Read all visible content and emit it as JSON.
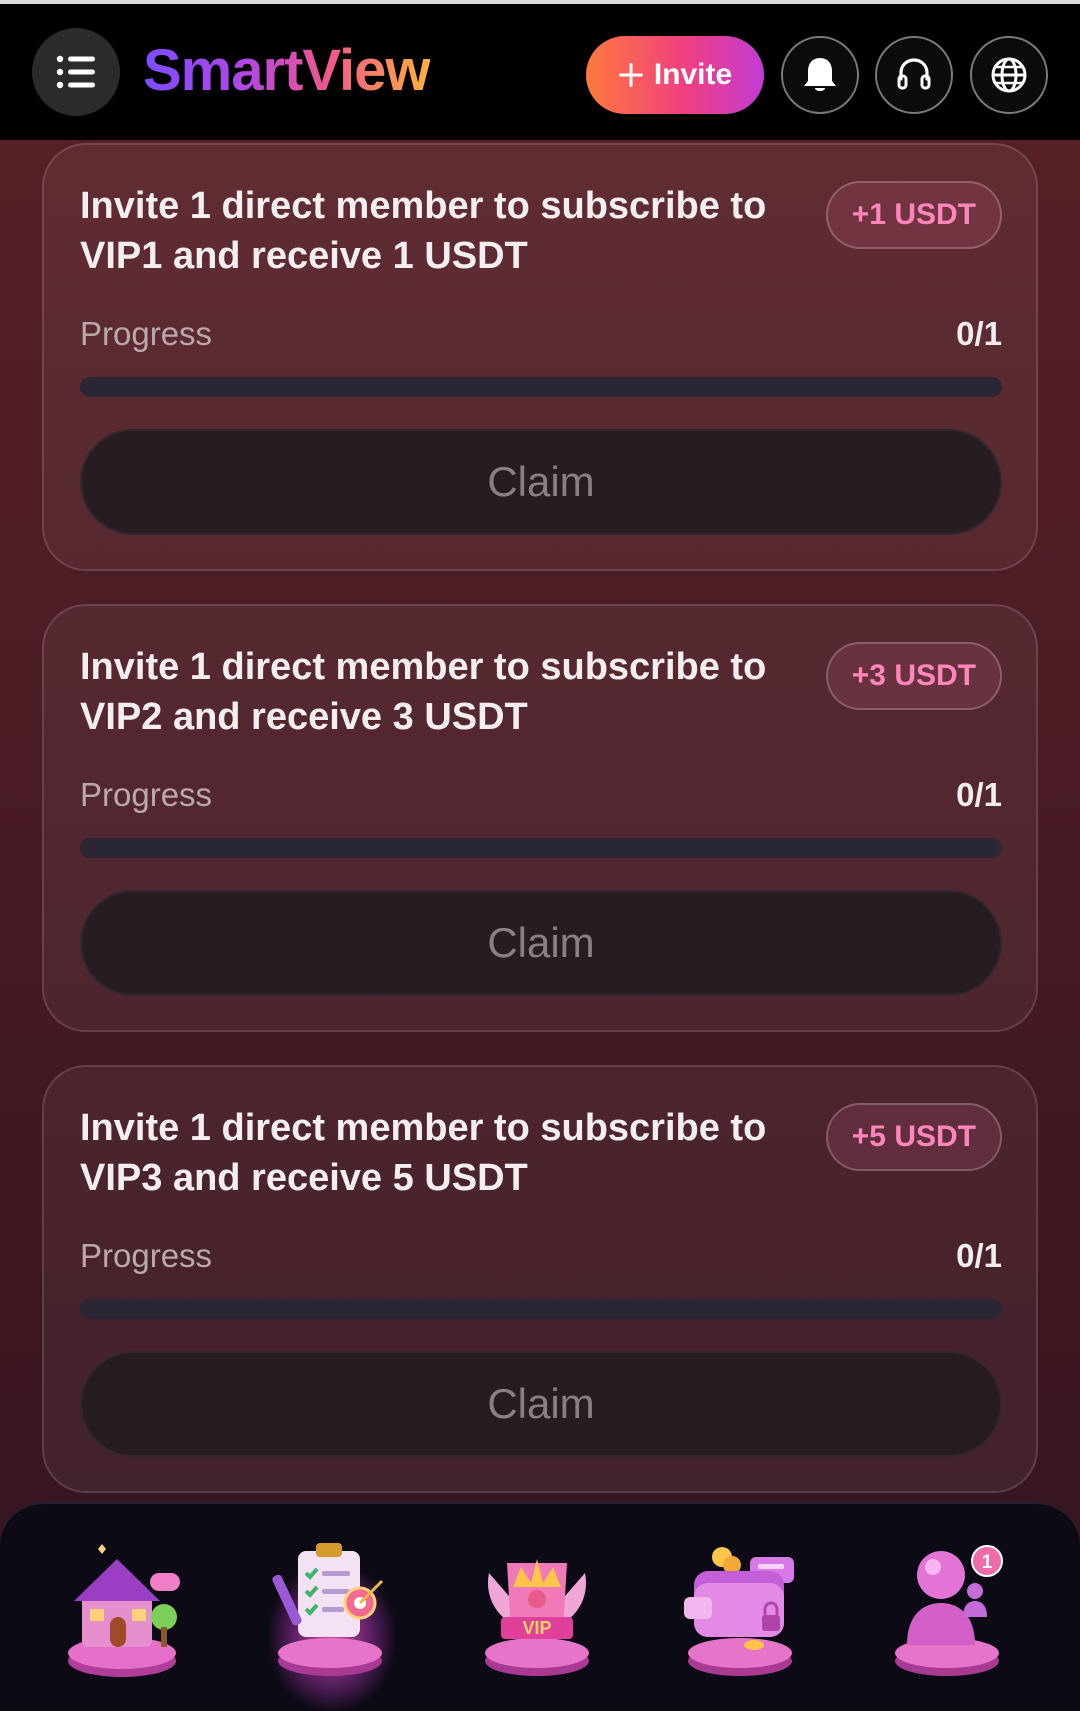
{
  "header": {
    "logo_text": "SmartView",
    "invite_label": "Invite",
    "icons": [
      "menu-icon",
      "bell-icon",
      "headset-icon",
      "globe-icon"
    ]
  },
  "tasks": [
    {
      "title": "Invite 1 direct member to subscribe to VIP1 and receive 1 USDT",
      "reward": "+1 USDT",
      "progress_label": "Progress",
      "progress_text": "0/1",
      "progress_fraction": 0,
      "claim_label": "Claim"
    },
    {
      "title": "Invite 1 direct member to subscribe to VIP2 and receive 3 USDT",
      "reward": "+3 USDT",
      "progress_label": "Progress",
      "progress_text": "0/1",
      "progress_fraction": 0,
      "claim_label": "Claim"
    },
    {
      "title": "Invite 1 direct member to subscribe to VIP3 and receive 5 USDT",
      "reward": "+5 USDT",
      "progress_label": "Progress",
      "progress_text": "0/1",
      "progress_fraction": 0,
      "claim_label": "Claim"
    }
  ],
  "bottom_nav": {
    "active_index": 1,
    "items": [
      {
        "icon": "home-icon"
      },
      {
        "icon": "tasks-icon"
      },
      {
        "icon": "vip-icon",
        "badge_text": "VIP"
      },
      {
        "icon": "wallet-icon"
      },
      {
        "icon": "profile-icon",
        "notification_count": "1"
      }
    ]
  },
  "colors": {
    "accent_pink": "#f03f7f",
    "accent_orange": "#ff7a3d",
    "reward_text": "#ff86bd",
    "background": "#4a1b24"
  }
}
